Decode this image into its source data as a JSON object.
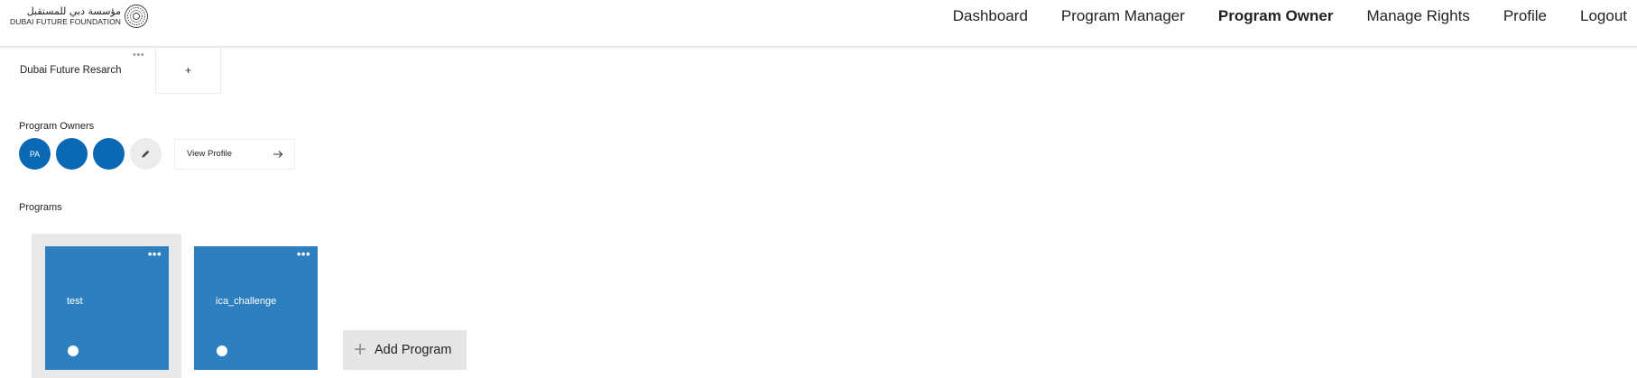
{
  "logo": {
    "arabic_text": "مؤسسة دبي للمستقبل",
    "english_text": "DUBAI FUTURE FOUNDATION",
    "icon": "dff-logo-icon"
  },
  "nav": {
    "items": [
      {
        "label": "Dashboard",
        "active": false
      },
      {
        "label": "Program Manager",
        "active": false
      },
      {
        "label": "Program Owner",
        "active": true
      },
      {
        "label": "Manage Rights",
        "active": false
      },
      {
        "label": "Profile",
        "active": false
      },
      {
        "label": "Logout",
        "active": false
      }
    ]
  },
  "organization": {
    "name": "Dubai Future Resarch",
    "menu_dots": "•••",
    "add_label": "+"
  },
  "program_owners": {
    "heading": "Program Owners",
    "avatars": [
      {
        "initials": "PA"
      },
      {
        "initials": ""
      },
      {
        "initials": ""
      }
    ],
    "edit_icon": "pencil-icon",
    "view_profile_label": "View Profile",
    "view_profile_icon": "arrow-right-icon"
  },
  "programs": {
    "heading": "Programs",
    "cards": [
      {
        "title": "test",
        "menu_dots": "•••",
        "selected": true
      },
      {
        "title": "ica_challenge",
        "menu_dots": "•••",
        "selected": false
      }
    ],
    "add_label": "Add Program",
    "add_icon": "plus-icon"
  },
  "colors": {
    "avatar_blue": "#0a68b4",
    "card_blue": "#2e7fbf",
    "selected_bg": "#e9e9e9",
    "add_button_bg": "#e6e6e6"
  }
}
